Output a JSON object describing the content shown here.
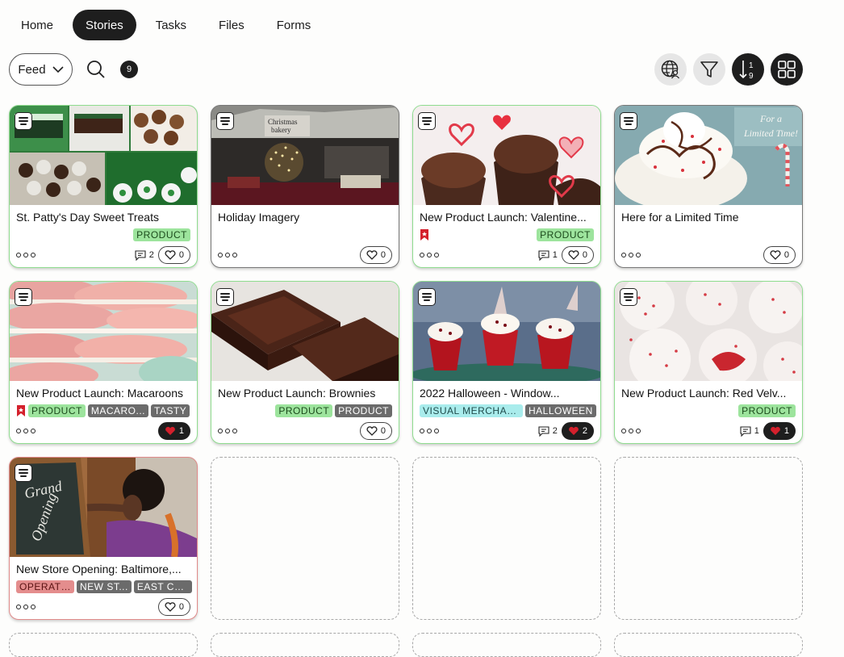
{
  "nav": {
    "tabs": [
      {
        "label": "Home"
      },
      {
        "label": "Stories",
        "active": true
      },
      {
        "label": "Tasks"
      },
      {
        "label": "Files"
      },
      {
        "label": "Forms"
      }
    ]
  },
  "toolbar": {
    "feed_label": "Feed",
    "count": "9",
    "icons": [
      "chevron-down-icon",
      "search-icon",
      "globe-people-icon",
      "filter-icon",
      "sort-numeric-icon",
      "grid-view-icon"
    ]
  },
  "colors": {
    "accent_dark": "#1e1e1e",
    "tag_green": "#9de49d",
    "tag_gray": "#6b6b6b",
    "tag_cyan": "#a9ecec",
    "tag_red": "#e48d8d",
    "heart_red": "#d4202c"
  },
  "cards": [
    {
      "title": "St. Patty's Day Sweet Treats",
      "tags": [
        "PRODUCT"
      ],
      "comments": "2",
      "likes": "0"
    },
    {
      "title": "Holiday Imagery",
      "tags": [],
      "likes": "0"
    },
    {
      "title": "New Product Launch: Valentine...",
      "tags": [
        "PRODUCT"
      ],
      "comments": "1",
      "likes": "0",
      "bookmarked": true
    },
    {
      "title": "Here for a Limited Time",
      "tags": [],
      "likes": "0",
      "image_text": [
        "For a",
        "Limited Time!"
      ]
    },
    {
      "title": "New Product Launch: Macaroons",
      "tags": [
        "PRODUCT",
        "MACARO...",
        "TASTY"
      ],
      "likes": "1",
      "liked": true,
      "bookmarked": true
    },
    {
      "title": "New Product Launch: Brownies",
      "tags": [
        "PRODUCT",
        "PRODUCT"
      ],
      "likes": "0"
    },
    {
      "title": "2022 Halloween - Window...",
      "tags": [
        "VISUAL MERCHAN...",
        "HALLOWEEN"
      ],
      "comments": "2",
      "likes": "2",
      "liked": true
    },
    {
      "title": "New Product Launch: Red Velv...",
      "tags": [
        "PRODUCT"
      ],
      "comments": "1",
      "likes": "1",
      "liked": true
    },
    {
      "title": "New Store Opening: Baltimore,...",
      "tags": [
        "OPERATI...",
        "NEW ST...",
        "EAST CO..."
      ],
      "likes": "0",
      "image_text": [
        "Grand",
        "Opening"
      ]
    }
  ],
  "image_text": {
    "bakery_sign": [
      "Christmas",
      "bakery"
    ]
  }
}
